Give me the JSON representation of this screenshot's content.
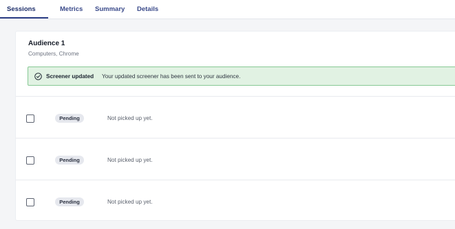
{
  "tabs": {
    "sessions": "Sessions",
    "metrics": "Metrics",
    "summary": "Summary",
    "details": "Details",
    "active": "Sessions"
  },
  "audience": {
    "title": "Audience 1",
    "subtitle": "Computers, Chrome"
  },
  "banner": {
    "icon": "check-circle-icon",
    "title": "Screener updated",
    "message": "Your updated screener has been sent to your audience.",
    "bg_color": "#e1f2e3",
    "border_color": "#86c893"
  },
  "sessions": [
    {
      "status": "Pending",
      "detail": "Not picked up yet.",
      "checked": false
    },
    {
      "status": "Pending",
      "detail": "Not picked up yet.",
      "checked": false
    },
    {
      "status": "Pending",
      "detail": "Not picked up yet.",
      "checked": false
    }
  ]
}
